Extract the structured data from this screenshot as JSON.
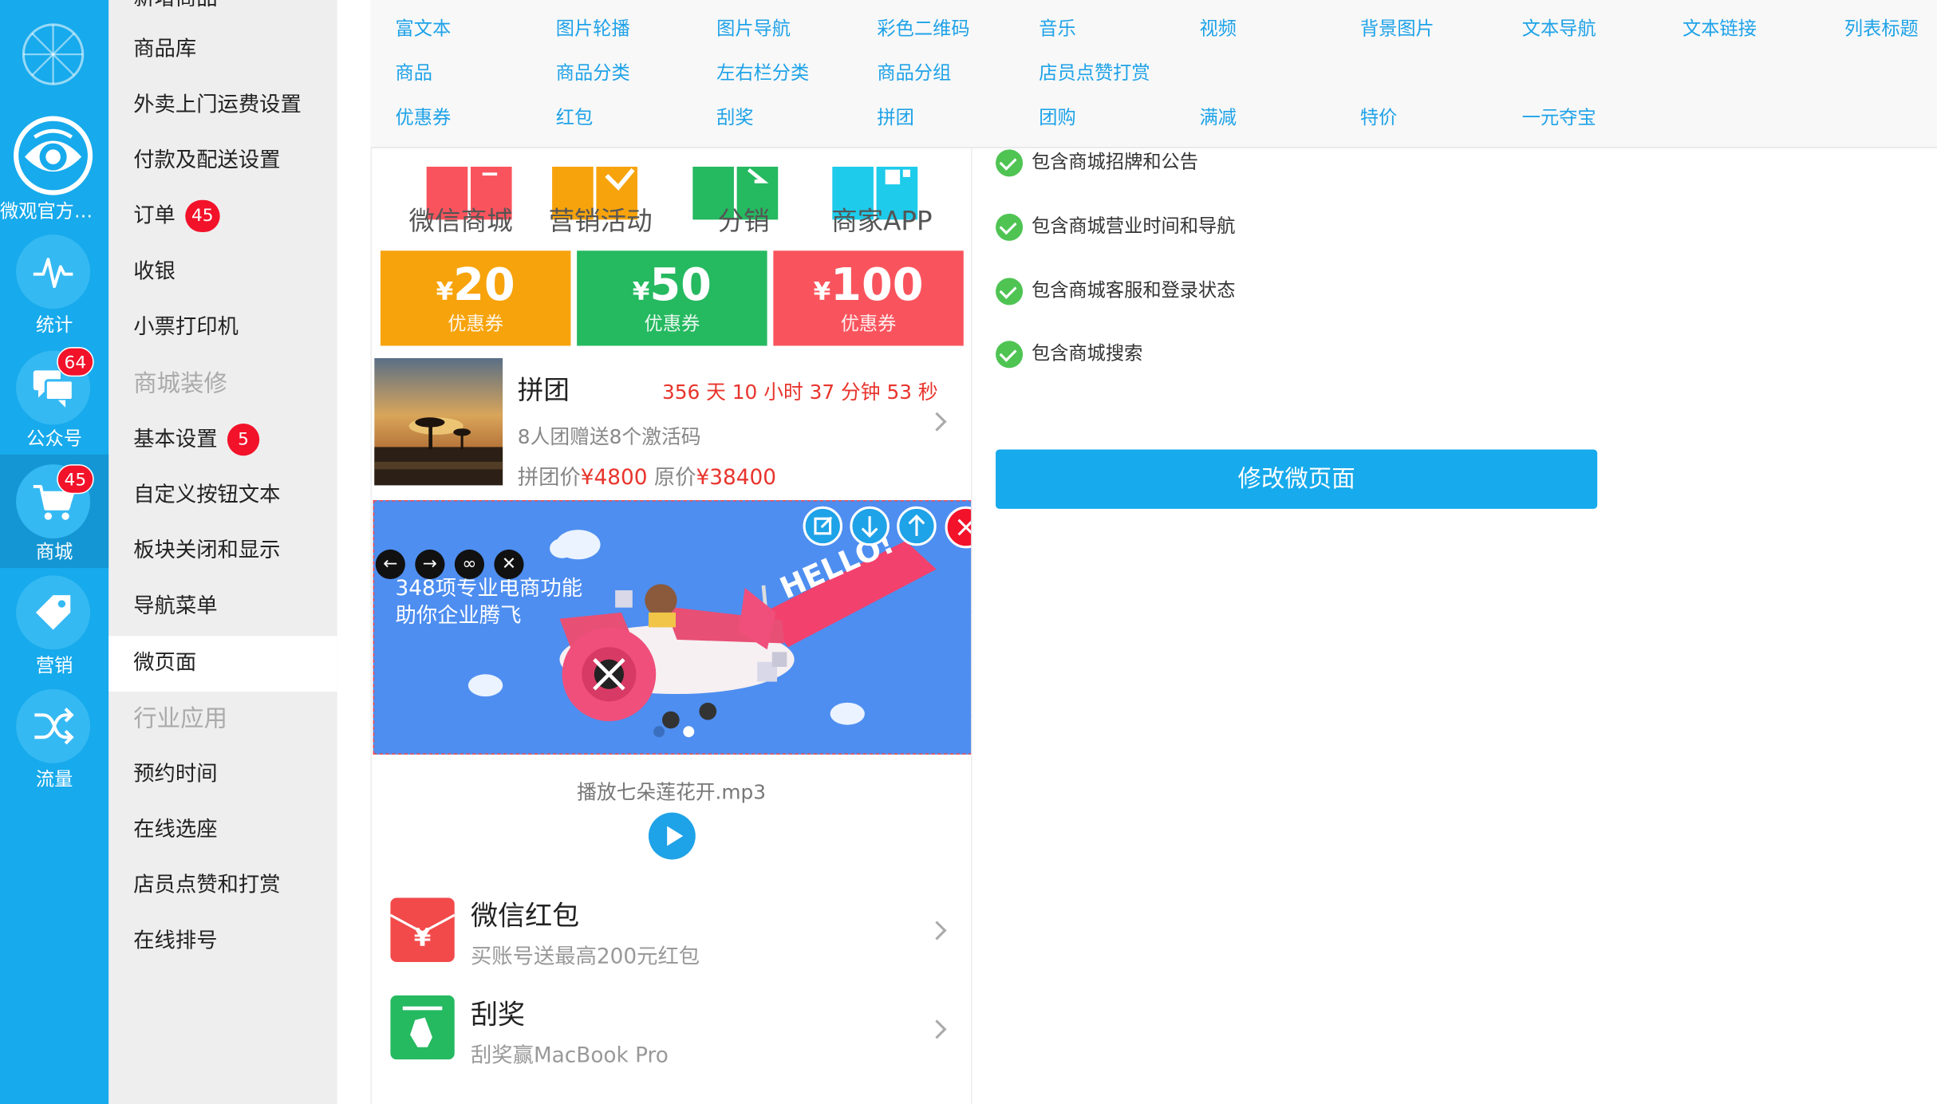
{
  "rail": {
    "items": [
      {
        "label": "",
        "icon": "wheel-icon"
      },
      {
        "label": "微观官方商…",
        "icon": "eye-icon"
      },
      {
        "label": "统计",
        "icon": "pulse-icon"
      },
      {
        "label": "公众号",
        "icon": "chat-icon",
        "badge": "64"
      },
      {
        "label": "商城",
        "icon": "cart-icon",
        "badge": "45"
      },
      {
        "label": "营销",
        "icon": "tag-icon"
      },
      {
        "label": "流量",
        "icon": "shuffle-icon"
      }
    ]
  },
  "menu": {
    "items": [
      {
        "label": "新增商品"
      },
      {
        "label": "商品库"
      },
      {
        "label": "外卖上门运费设置"
      },
      {
        "label": "付款及配送设置"
      },
      {
        "label": "订单",
        "badge": "45"
      },
      {
        "label": "收银"
      },
      {
        "label": "小票打印机"
      },
      {
        "label": "商城装修"
      },
      {
        "label": "基本设置",
        "badge": "5"
      },
      {
        "label": "自定义按钮文本"
      },
      {
        "label": "板块关闭和显示"
      },
      {
        "label": "导航菜单"
      },
      {
        "label": "微页面"
      },
      {
        "label": "行业应用"
      },
      {
        "label": "预约时间"
      },
      {
        "label": "在线选座"
      },
      {
        "label": "店员点赞和打赏"
      },
      {
        "label": "在线排号"
      }
    ]
  },
  "toolbar": {
    "row1": [
      "富文本",
      "图片轮播",
      "图片导航",
      "彩色二维码",
      "音乐",
      "视频",
      "背景图片",
      "文本导航",
      "文本链接",
      "列表标题"
    ],
    "row2": [
      "商品",
      "商品分类",
      "左右栏分类",
      "商品分组",
      "店员点赞打赏"
    ],
    "row3": [
      "优惠券",
      "红包",
      "刮奖",
      "拼团",
      "团购",
      "满减",
      "特价",
      "一元夺宝"
    ]
  },
  "preview": {
    "features": [
      "微信商城",
      "营销活动",
      "分销",
      "商家APP"
    ],
    "coupons": [
      {
        "currency": "¥",
        "amount": "20",
        "label": "优惠券",
        "color": "#f7a30c"
      },
      {
        "currency": "¥",
        "amount": "50",
        "label": "优惠券",
        "color": "#25b960"
      },
      {
        "currency": "¥",
        "amount": "100",
        "label": "优惠券",
        "color": "#f9545d"
      }
    ],
    "group_buy": {
      "title": "拼团",
      "countdown": "356 天 10 小时 37 分钟 53 秒",
      "desc": "8人团赠送8个激活码",
      "price_label": "拼团价",
      "price": "¥4800",
      "orig_label": "原价",
      "orig_price": "¥38400"
    },
    "banner": {
      "line1": "348项专业电商功能",
      "line2": "助你企业腾飞",
      "flag_text": "HELLO!"
    },
    "music": {
      "title": "播放七朵莲花开.mp3"
    },
    "red_packet": {
      "title": "微信红包",
      "subtitle": "买账号送最高200元红包",
      "icon_text": "¥"
    },
    "scratch": {
      "title": "刮奖",
      "subtitle": "刮奖赢MacBook Pro"
    }
  },
  "settings": {
    "checks": [
      "包含商城招牌和公告",
      "包含商城营业时间和导航",
      "包含商城客服和登录状态",
      "包含商城搜索"
    ],
    "edit_button": "修改微页面"
  }
}
